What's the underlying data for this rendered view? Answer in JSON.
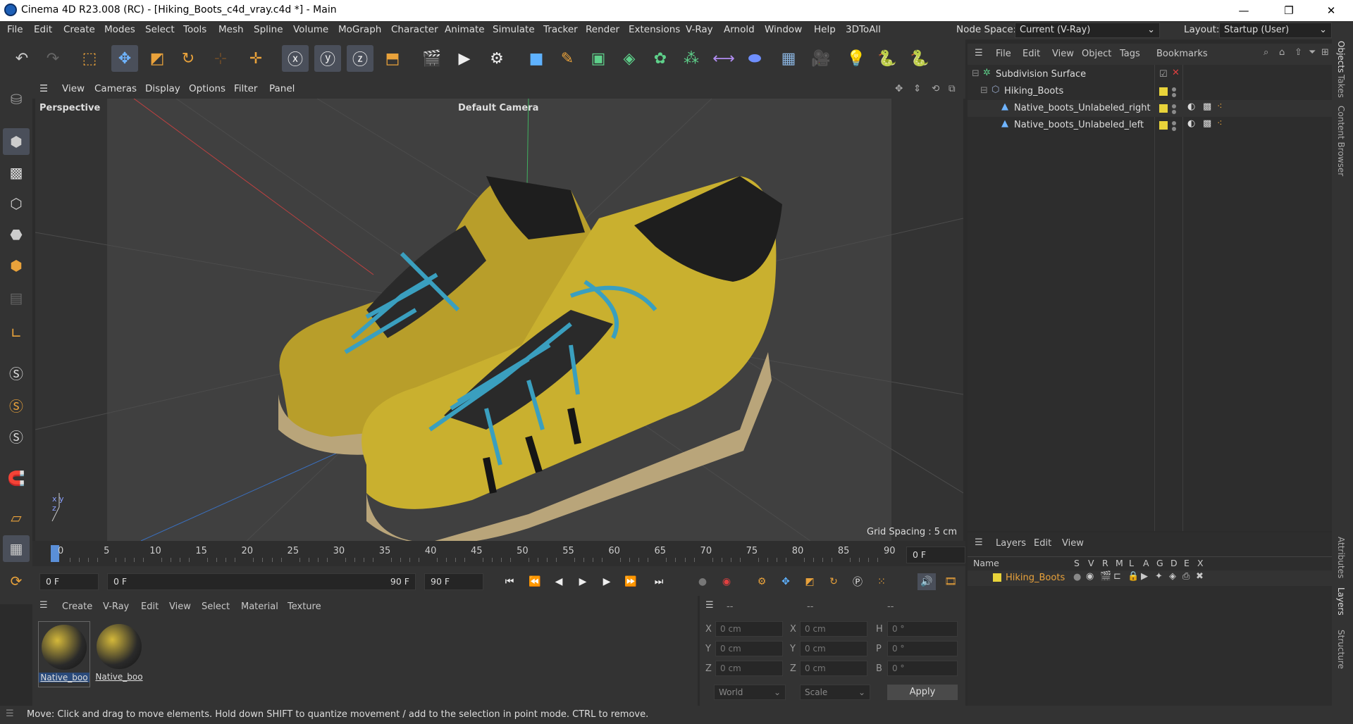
{
  "window": {
    "title": "Cinema 4D R23.008 (RC) - [Hiking_Boots_c4d_vray.c4d *] - Main",
    "min": "—",
    "max": "❐",
    "close": "✕"
  },
  "menubar": {
    "items": [
      "File",
      "Edit",
      "Create",
      "Modes",
      "Select",
      "Tools",
      "Mesh",
      "Spline",
      "Volume",
      "MoGraph",
      "Character",
      "Animate",
      "Simulate",
      "Tracker",
      "Render",
      "Extensions",
      "V-Ray",
      "Arnold",
      "Window",
      "Help",
      "3DToAll"
    ],
    "node_space_label": "Node Space:",
    "node_space_value": "Current (V-Ray)",
    "layout_label": "Layout:",
    "layout_value": "Startup (User)"
  },
  "viewport_menu": [
    "View",
    "Cameras",
    "Display",
    "Options",
    "Filter",
    "Panel"
  ],
  "viewport": {
    "name": "Perspective",
    "camera": "Default Camera",
    "grid_spacing": "Grid Spacing : 5 cm"
  },
  "timeline": {
    "ticks": [
      "0",
      "5",
      "10",
      "15",
      "20",
      "25",
      "30",
      "35",
      "40",
      "45",
      "50",
      "55",
      "60",
      "65",
      "70",
      "75",
      "80",
      "85",
      "90"
    ],
    "current_frame": "0 F"
  },
  "playbar": {
    "start": "0 F",
    "range_start": "0 F",
    "range_end": "90 F",
    "end": "90 F"
  },
  "material_menu": [
    "Create",
    "V-Ray",
    "Edit",
    "View",
    "Select",
    "Material",
    "Texture"
  ],
  "materials": [
    {
      "name": "Native_boo"
    },
    {
      "name": "Native_boo"
    }
  ],
  "coords": {
    "headers": [
      "--",
      "--",
      "--"
    ],
    "rows": [
      {
        "a": "X",
        "av": "0 cm",
        "b": "X",
        "bv": "0 cm",
        "c": "H",
        "cv": "0 °"
      },
      {
        "a": "Y",
        "av": "0 cm",
        "b": "Y",
        "bv": "0 cm",
        "c": "P",
        "cv": "0 °"
      },
      {
        "a": "Z",
        "av": "0 cm",
        "b": "Z",
        "bv": "0 cm",
        "c": "B",
        "cv": "0 °"
      }
    ],
    "world": "World",
    "scale": "Scale",
    "apply": "Apply"
  },
  "status": "Move: Click and drag to move elements. Hold down SHIFT to quantize movement / add to the selection in point mode. CTRL to remove.",
  "objects_menu": [
    "File",
    "Edit",
    "View",
    "Object",
    "Tags",
    "Bookmarks"
  ],
  "objects": [
    {
      "name": "Subdivision Surface"
    },
    {
      "name": "Hiking_Boots"
    },
    {
      "name": "Native_boots_Unlabeled_right"
    },
    {
      "name": "Native_boots_Unlabeled_left"
    }
  ],
  "layers_menu": [
    "Layers",
    "Edit",
    "View"
  ],
  "layers_columns": [
    "Name",
    "S",
    "V",
    "R",
    "M",
    "L",
    "A",
    "G",
    "D",
    "E",
    "X"
  ],
  "layers": [
    {
      "name": "Hiking_Boots",
      "color": "#e8d33a"
    }
  ],
  "right_tabs": [
    "Objects",
    "Takes",
    "Content Browser",
    "Attributes",
    "Layers",
    "Structure"
  ],
  "colors": {
    "accent": "#4a8fd8",
    "boot_yellow": "#c9b02f",
    "lace_blue": "#3a9fbf"
  }
}
